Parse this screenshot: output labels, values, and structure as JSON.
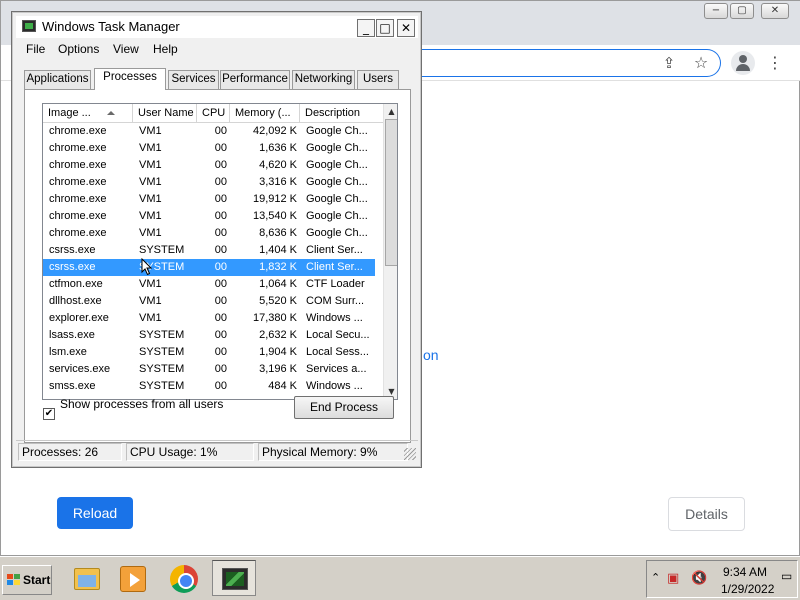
{
  "chrome": {
    "window_controls": [
      "−",
      "▢",
      "✕"
    ],
    "link_fragment": "on",
    "reload_label": "Reload",
    "details_label": "Details"
  },
  "task_manager": {
    "title": "Windows Task Manager",
    "title_buttons": {
      "minimize": "_",
      "maximize": "□",
      "close": "✕"
    },
    "menu": [
      "File",
      "Options",
      "View",
      "Help"
    ],
    "tabs": [
      {
        "label": "Applications",
        "active": false
      },
      {
        "label": "Processes",
        "active": true
      },
      {
        "label": "Services",
        "active": false
      },
      {
        "label": "Performance",
        "active": false
      },
      {
        "label": "Networking",
        "active": false
      },
      {
        "label": "Users",
        "active": false
      }
    ],
    "columns": [
      "Image ...",
      "User Name",
      "CPU",
      "Memory (...",
      "Description"
    ],
    "processes": [
      {
        "name": "chrome.exe",
        "user": "VM1",
        "cpu": "00",
        "memory": "42,092 K",
        "description": "Google Ch..."
      },
      {
        "name": "chrome.exe",
        "user": "VM1",
        "cpu": "00",
        "memory": "1,636 K",
        "description": "Google Ch..."
      },
      {
        "name": "chrome.exe",
        "user": "VM1",
        "cpu": "00",
        "memory": "4,620 K",
        "description": "Google Ch..."
      },
      {
        "name": "chrome.exe",
        "user": "VM1",
        "cpu": "00",
        "memory": "3,316 K",
        "description": "Google Ch..."
      },
      {
        "name": "chrome.exe",
        "user": "VM1",
        "cpu": "00",
        "memory": "19,912 K",
        "description": "Google Ch..."
      },
      {
        "name": "chrome.exe",
        "user": "VM1",
        "cpu": "00",
        "memory": "13,540 K",
        "description": "Google Ch..."
      },
      {
        "name": "chrome.exe",
        "user": "VM1",
        "cpu": "00",
        "memory": "8,636 K",
        "description": "Google Ch..."
      },
      {
        "name": "csrss.exe",
        "user": "SYSTEM",
        "cpu": "00",
        "memory": "1,404 K",
        "description": "Client Ser..."
      },
      {
        "name": "csrss.exe",
        "user": "SYSTEM",
        "cpu": "00",
        "memory": "1,832 K",
        "description": "Client Ser...",
        "selected": true
      },
      {
        "name": "ctfmon.exe",
        "user": "VM1",
        "cpu": "00",
        "memory": "1,064 K",
        "description": "CTF Loader"
      },
      {
        "name": "dllhost.exe",
        "user": "VM1",
        "cpu": "00",
        "memory": "5,520 K",
        "description": "COM Surr..."
      },
      {
        "name": "explorer.exe",
        "user": "VM1",
        "cpu": "00",
        "memory": "17,380 K",
        "description": "Windows ..."
      },
      {
        "name": "lsass.exe",
        "user": "SYSTEM",
        "cpu": "00",
        "memory": "2,632 K",
        "description": "Local Secu..."
      },
      {
        "name": "lsm.exe",
        "user": "SYSTEM",
        "cpu": "00",
        "memory": "1,904 K",
        "description": "Local Sess..."
      },
      {
        "name": "services.exe",
        "user": "SYSTEM",
        "cpu": "00",
        "memory": "3,196 K",
        "description": "Services a..."
      },
      {
        "name": "smss.exe",
        "user": "SYSTEM",
        "cpu": "00",
        "memory": "484 K",
        "description": "Windows ..."
      }
    ],
    "show_all_users": {
      "label": "Show processes from all users",
      "checked": true,
      "mark": "✔"
    },
    "end_process_label": "End Process",
    "status": {
      "processes": "Processes: 26",
      "cpu": "CPU Usage: 1%",
      "memory": "Physical Memory: 9%"
    }
  },
  "taskbar": {
    "start_label": "Start",
    "apps": [
      "folder-icon",
      "media-player-icon",
      "chrome-icon",
      "task-manager-icon"
    ],
    "clock_time": "9:34 AM",
    "clock_date": "1/29/2022"
  }
}
